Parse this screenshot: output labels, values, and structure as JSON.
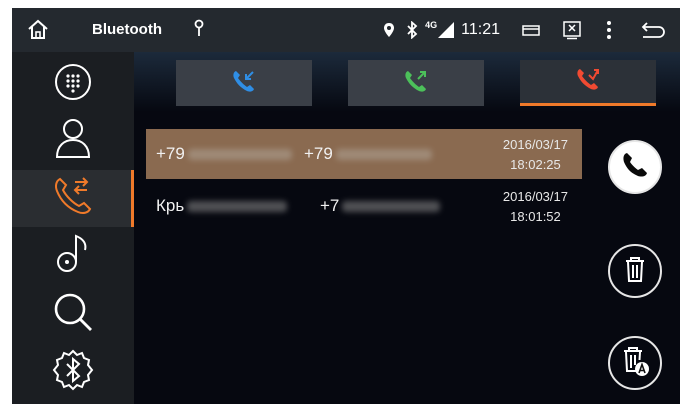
{
  "status_bar": {
    "title": "Bluetooth",
    "network": "4G",
    "time": "11:21"
  },
  "sidebar": {
    "items": [
      {
        "name": "dialpad"
      },
      {
        "name": "contacts"
      },
      {
        "name": "call-log",
        "active": true
      },
      {
        "name": "music"
      },
      {
        "name": "search"
      },
      {
        "name": "bluetooth-settings"
      }
    ]
  },
  "tabs": [
    {
      "name": "incoming-calls",
      "color": "#2f8ee5"
    },
    {
      "name": "outgoing-calls",
      "color": "#4cc05a"
    },
    {
      "name": "missed-calls",
      "color": "#f04a32",
      "active": true
    }
  ],
  "calls": [
    {
      "name": "+79",
      "number": "+79",
      "date": "2016/03/17",
      "time": "18:02:25",
      "selected": true
    },
    {
      "name": "Крь",
      "number": "+7",
      "date": "2016/03/17",
      "time": "18:01:52",
      "selected": false
    }
  ],
  "colors": {
    "accent": "#f07a2a",
    "selected_row": "#8a6a50",
    "incoming": "#2f8ee5",
    "outgoing": "#4cc05a",
    "missed": "#f04a32"
  }
}
